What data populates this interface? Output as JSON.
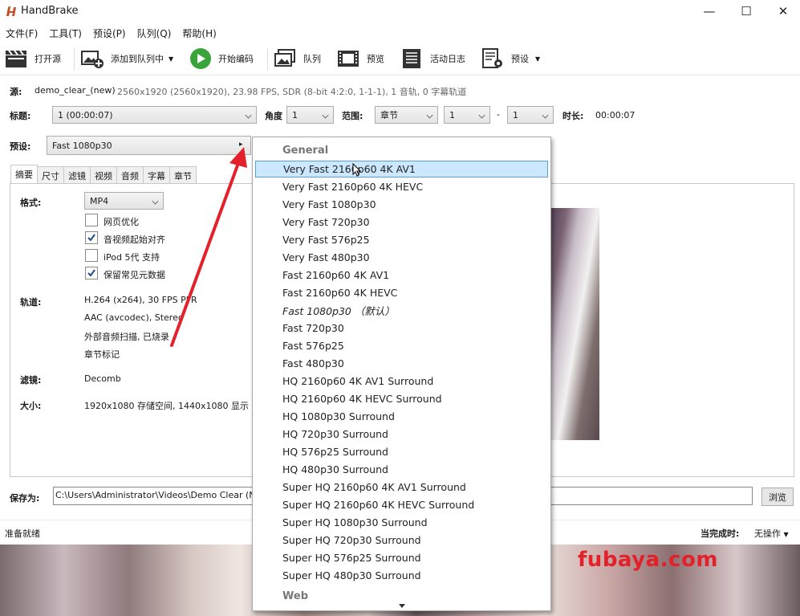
{
  "window": {
    "title": "HandBrake",
    "minimize": "—",
    "maximize": "☐",
    "close": "✕"
  },
  "menu": [
    "文件(F)",
    "工具(T)",
    "预设(P)",
    "队列(Q)",
    "帮助(H)"
  ],
  "toolbar": {
    "open_source": "打开源",
    "add_to_queue": "添加到队列中",
    "start_encode": "开始编码",
    "queue": "队列",
    "preview": "预览",
    "activity_log": "活动日志",
    "presets": "预设"
  },
  "source": {
    "label": "源:",
    "name": "demo_clear_(new)",
    "info": "2560x1920 (2560x1920), 23.98 FPS, SDR (8-bit 4:2:0, 1-1-1), 1 音轨, 0 字幕轨道"
  },
  "title_row": {
    "title_label": "标题:",
    "title_value": "1  (00:00:07)",
    "angle_label": "角度",
    "angle_value": "1",
    "range_label": "范围:",
    "range_type": "章节",
    "range_start": "1",
    "range_dash": "-",
    "range_end": "1",
    "duration_label": "时长:",
    "duration_value": "00:00:07"
  },
  "preset_row": {
    "label": "预设:",
    "value": "Fast 1080p30"
  },
  "tabs": [
    "摘要",
    "尺寸",
    "滤镜",
    "视频",
    "音频",
    "字幕",
    "章节"
  ],
  "summary": {
    "format_label": "格式:",
    "format_value": "MP4",
    "web_optimize": "网页优化",
    "align_av": "音视频起始对齐",
    "ipod": "iPod 5代 支持",
    "keep_metadata": "保留常见元数据",
    "tracks_label": "轨道:",
    "track1": "H.264 (x264), 30 FPS PFR",
    "track2": "AAC (avcodec), Stereo",
    "track3": "外部音频扫描, 已烧录",
    "track4": "章节标记",
    "filters_label": "滤镜:",
    "filters_value": "Decomb",
    "size_label": "大小:",
    "size_value": "1920x1080 存储空间, 1440x1080 显示"
  },
  "checkboxes": {
    "web_optimize": false,
    "align_av": true,
    "ipod": false,
    "keep_metadata": true
  },
  "save": {
    "label": "保存为:",
    "path": "C:\\Users\\Administrator\\Videos\\Demo Clear (Ne",
    "browse": "浏览"
  },
  "status": {
    "ready": "准备就绪",
    "on_complete_label": "当完成时:",
    "on_complete_value": "无操作"
  },
  "watermark": "fubaya.com",
  "dropdown": {
    "group_general": "General",
    "items": [
      "Very Fast 2160p60 4K AV1",
      "Very Fast 2160p60 4K HEVC",
      "Very Fast 1080p30",
      "Very Fast 720p30",
      "Very Fast 576p25",
      "Very Fast 480p30",
      "Fast 2160p60 4K AV1",
      "Fast 2160p60 4K HEVC",
      "Fast 1080p30  （默认）",
      "Fast 720p30",
      "Fast 576p25",
      "Fast 480p30",
      "HQ 2160p60 4K AV1 Surround",
      "HQ 2160p60 4K HEVC Surround",
      "HQ 1080p30 Surround",
      "HQ 720p30 Surround",
      "HQ 576p25 Surround",
      "HQ 480p30 Surround",
      "Super HQ 2160p60 4K AV1 Surround",
      "Super HQ 2160p60 4K HEVC Surround",
      "Super HQ 1080p30 Surround",
      "Super HQ 720p30 Surround",
      "Super HQ 576p25 Surround",
      "Super HQ 480p30 Surround"
    ],
    "group_web": "Web"
  },
  "colors": {
    "arrow": "#e4212a",
    "selection": "#cce8ff",
    "selection_border": "#5aa0d8"
  }
}
